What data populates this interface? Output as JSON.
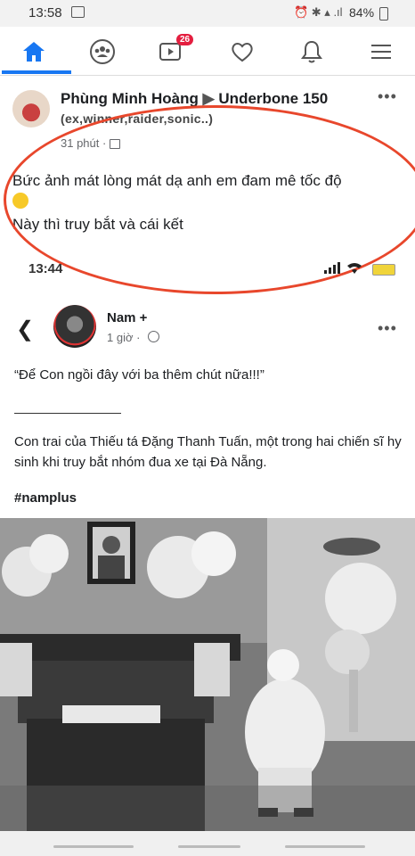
{
  "status_bar": {
    "time": "13:58",
    "icons": "⏰ ✱ ▴ .ıl",
    "battery": "84%"
  },
  "nav": {
    "active": "home",
    "items": [
      "home-icon",
      "groups-icon",
      "watch-icon",
      "dating-icon",
      "notifications-icon",
      "menu-icon"
    ],
    "watch_badge": "26"
  },
  "post1": {
    "author": "Phùng Minh Hoàng",
    "arrow": "▶",
    "group": "Underbone 150",
    "group_sub": "(ex,winner,raider,sonic..)",
    "time": "31 phút ·",
    "text_line1": "Bức ảnh mát lòng mát dạ anh em đam mê tốc độ",
    "text_line2": "Này thì truy bắt và cái kết",
    "highlight_color": "#e8472c"
  },
  "inner_screenshot": {
    "time": "13:44"
  },
  "post2": {
    "author": "Nam +",
    "time": "1 giờ ·",
    "quote": "“Để Con ngồi đây với ba thêm chút nữa!!!”",
    "body": "Con trai của Thiếu tá Đặng Thanh Tuấn, một trong hai chiến sĩ hy sinh khi truy bắt nhóm đua xe tại Đà Nẵng.",
    "hashtag": "#namplus"
  },
  "colors": {
    "accent": "#1877f2",
    "badge": "#e41e3f"
  }
}
